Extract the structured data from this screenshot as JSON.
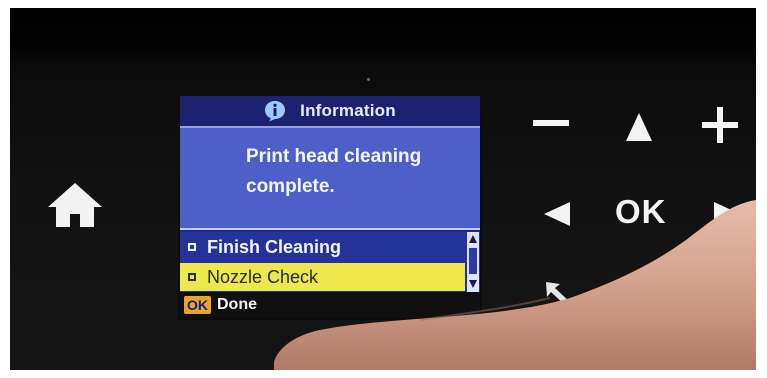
{
  "screen": {
    "header": {
      "title": "Information",
      "icon": "info-icon"
    },
    "message": {
      "line1": "Print head cleaning",
      "line2": "complete."
    },
    "options": [
      {
        "label": "Finish Cleaning",
        "selected": false
      },
      {
        "label": "Nozzle Check",
        "selected": true
      }
    ],
    "footer": {
      "ok_badge": "OK",
      "done_label": "Done"
    },
    "colors": {
      "header_bg": "#1b2270",
      "message_bg": "#4d60c9",
      "selected_bg": "#ece84d",
      "footer_bg": "#101010",
      "ok_badge": "#e6a62a"
    }
  },
  "panel": {
    "home_icon": "home-icon",
    "ok_key_label": "OK",
    "keys": [
      "minus-icon",
      "arrow-up-icon",
      "plus-icon",
      "arrow-left-icon",
      "arrow-right-icon",
      "back-icon"
    ]
  }
}
